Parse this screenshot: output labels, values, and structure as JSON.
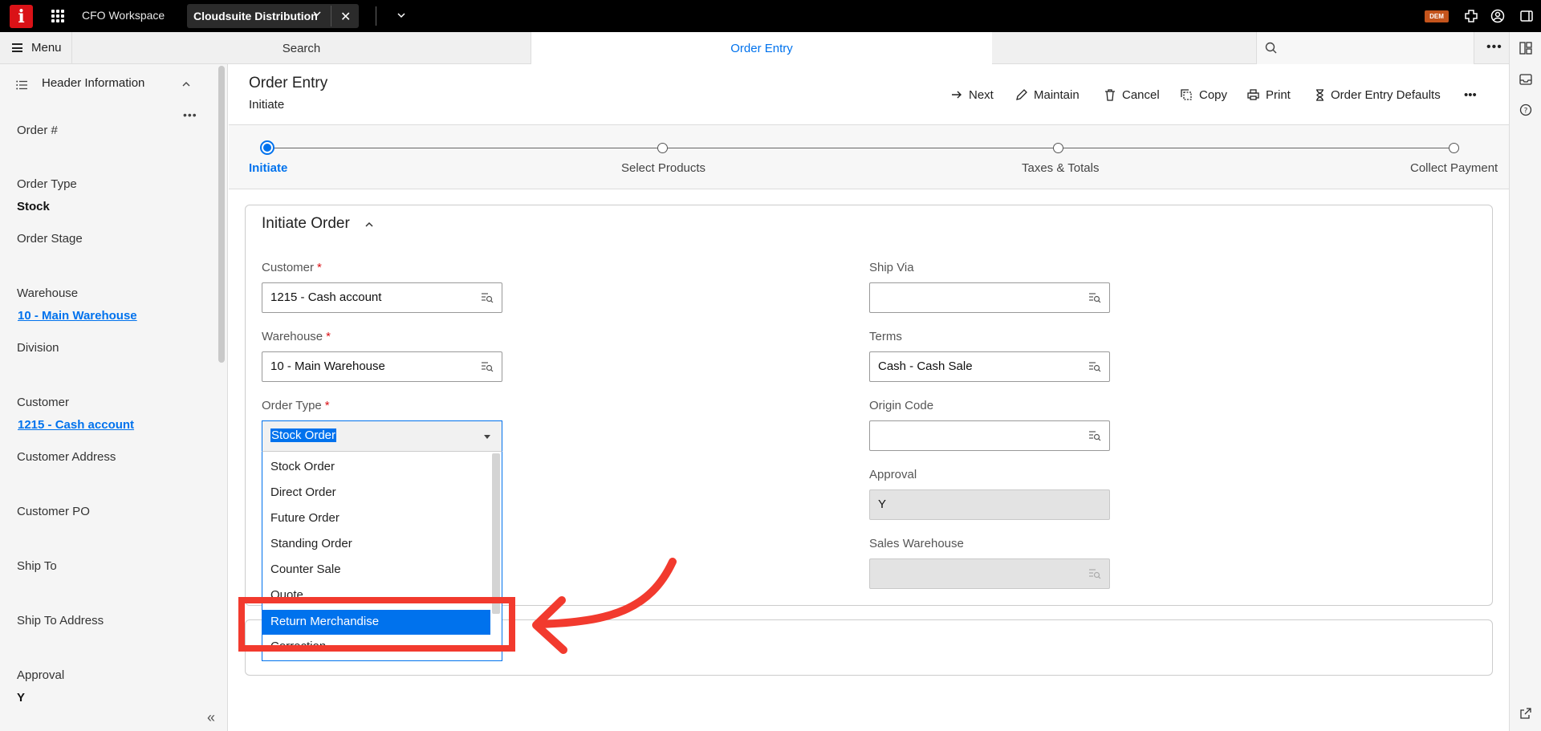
{
  "topbar": {
    "logo_letter": "i",
    "workspace": "CFO Workspace",
    "tab_label": "Cloudsuite Distribution",
    "badge": "DEM"
  },
  "subbar": {
    "menu_label": "Menu",
    "search_tab": "Search",
    "active_tab": "Order Entry",
    "search_placeholder": ""
  },
  "left_panel": {
    "title": "Header Information",
    "fields": [
      {
        "label": "Order #",
        "value": ""
      },
      {
        "label": "Order Type",
        "value": "Stock"
      },
      {
        "label": "Order Stage",
        "value": ""
      },
      {
        "label": "Warehouse",
        "value": "10 - Main Warehouse"
      },
      {
        "label": "Division",
        "value": ""
      },
      {
        "label": "Customer",
        "value": "1215 - Cash account"
      },
      {
        "label": "Customer Address",
        "value": ""
      },
      {
        "label": "Customer PO",
        "value": ""
      },
      {
        "label": "Ship To",
        "value": ""
      },
      {
        "label": "Ship To Address",
        "value": ""
      },
      {
        "label": "Approval",
        "value": "Y"
      }
    ]
  },
  "header": {
    "title": "Order Entry",
    "subtitle": "Initiate",
    "actions": [
      "Next",
      "Maintain",
      "Cancel",
      "Copy",
      "Print",
      "Order Entry Defaults"
    ]
  },
  "stepper": {
    "steps": [
      "Initiate",
      "Select Products",
      "Taxes & Totals",
      "Collect Payment"
    ],
    "active_index": 0
  },
  "form": {
    "section_title": "Initiate Order",
    "customer": {
      "label": "Customer",
      "value": "1215 - Cash account"
    },
    "warehouse": {
      "label": "Warehouse",
      "value": "10 - Main Warehouse"
    },
    "order_type": {
      "label": "Order Type",
      "value": "Stock Order",
      "options": [
        "Stock Order",
        "Direct Order",
        "Future Order",
        "Standing Order",
        "Counter Sale",
        "Quote",
        "Return Merchandise",
        "Correction"
      ],
      "highlighted": "Return Merchandise"
    },
    "ship_via": {
      "label": "Ship Via",
      "value": ""
    },
    "terms": {
      "label": "Terms",
      "value": "Cash - Cash Sale"
    },
    "origin_code": {
      "label": "Origin Code",
      "value": ""
    },
    "approval": {
      "label": "Approval",
      "value": "Y"
    },
    "sales_warehouse": {
      "label": "Sales Warehouse",
      "value": ""
    }
  },
  "colors": {
    "accent": "#0072ed",
    "brand": "#da1217",
    "annotation": "#f23a2e"
  }
}
